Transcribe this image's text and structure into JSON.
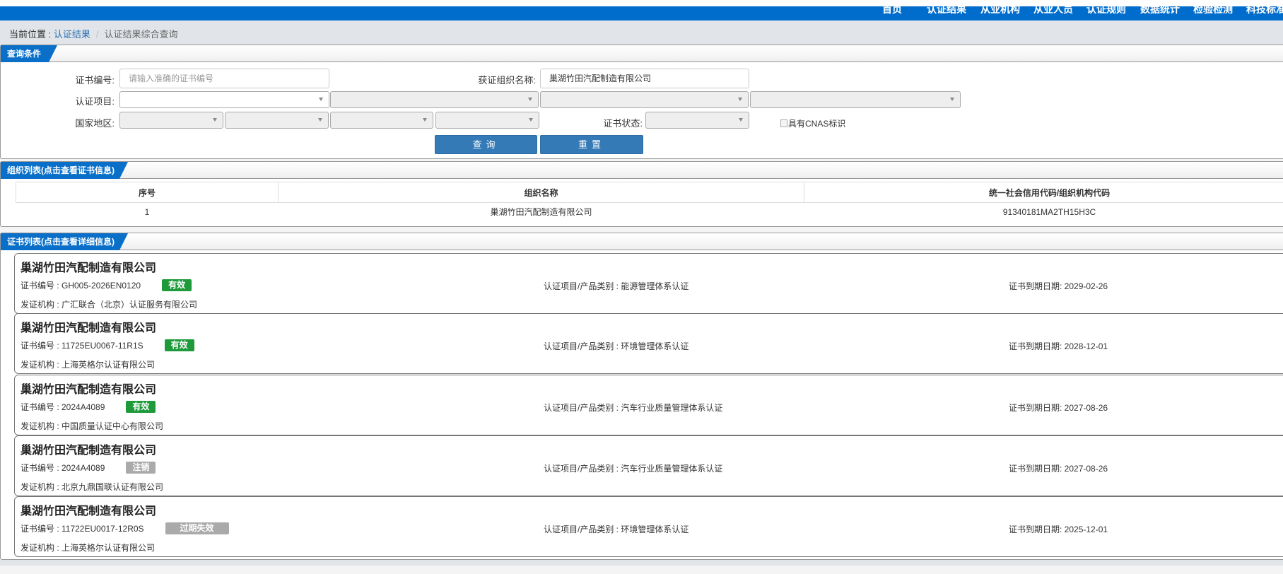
{
  "nav": [
    "首页",
    "认证结果",
    "从业机构",
    "从业人员",
    "认证规则",
    "数据统计",
    "检验检测",
    "科技标准"
  ],
  "breadcrumb": {
    "prefix": "当前位置 : ",
    "link": "认证结果",
    "sep": "/",
    "current": "认证结果综合查询"
  },
  "query": {
    "title": "查询条件",
    "cert_no_label": "证书编号:",
    "cert_no_placeholder": "请输入准确的证书编号",
    "org_label": "获证组织名称:",
    "org_value": "巢湖竹田汽配制造有限公司",
    "project_label": "认证项目:",
    "region_label": "国家地区:",
    "status_label": "证书状态:",
    "cnas_label": "具有CNAS标识",
    "search_button": "查询",
    "reset_button": "重置"
  },
  "org_list": {
    "title": "组织列表(点击查看证书信息)",
    "columns": [
      "序号",
      "组织名称",
      "统一社会信用代码/组织机构代码"
    ],
    "rows": [
      [
        "1",
        "巢湖竹田汽配制造有限公司",
        "91340181MA2TH15H3C"
      ]
    ]
  },
  "cert_list": {
    "title": "证书列表(点击查看详细信息)",
    "colors": {
      "valid": "#1e9a3a",
      "inactive": "#aaaaaa"
    },
    "items": [
      {
        "org": "巢湖竹田汽配制造有限公司",
        "cert_no": "证书编号 : GH005-2026EN0120",
        "status": "有效",
        "project": "认证项目/产品类别 : 能源管理体系认证",
        "expiry": "证书到期日期: 2029-02-26",
        "issuer": "发证机构 : 广汇联合（北京）认证服务有限公司"
      },
      {
        "org": "巢湖竹田汽配制造有限公司",
        "cert_no": "证书编号 : 11725EU0067-11R1S",
        "status": "有效",
        "project": "认证项目/产品类别 : 环境管理体系认证",
        "expiry": "证书到期日期: 2028-12-01",
        "issuer": "发证机构 : 上海英格尔认证有限公司"
      },
      {
        "org": "巢湖竹田汽配制造有限公司",
        "cert_no": "证书编号 : 2024A4089",
        "status": "有效",
        "project": "认证项目/产品类别 : 汽车行业质量管理体系认证",
        "expiry": "证书到期日期: 2027-08-26",
        "issuer": "发证机构 : 中国质量认证中心有限公司"
      },
      {
        "org": "巢湖竹田汽配制造有限公司",
        "cert_no": "证书编号 : 2024A4089",
        "status": "注销",
        "project": "认证项目/产品类别 : 汽车行业质量管理体系认证",
        "expiry": "证书到期日期: 2027-08-26",
        "issuer": "发证机构 : 北京九鼎国联认证有限公司"
      },
      {
        "org": "巢湖竹田汽配制造有限公司",
        "cert_no": "证书编号 : 11722EU0017-12R0S",
        "status": "过期失效",
        "project": "认证项目/产品类别 : 环境管理体系认证",
        "expiry": "证书到期日期: 2025-12-01",
        "issuer": "发证机构 : 上海英格尔认证有限公司"
      }
    ]
  }
}
